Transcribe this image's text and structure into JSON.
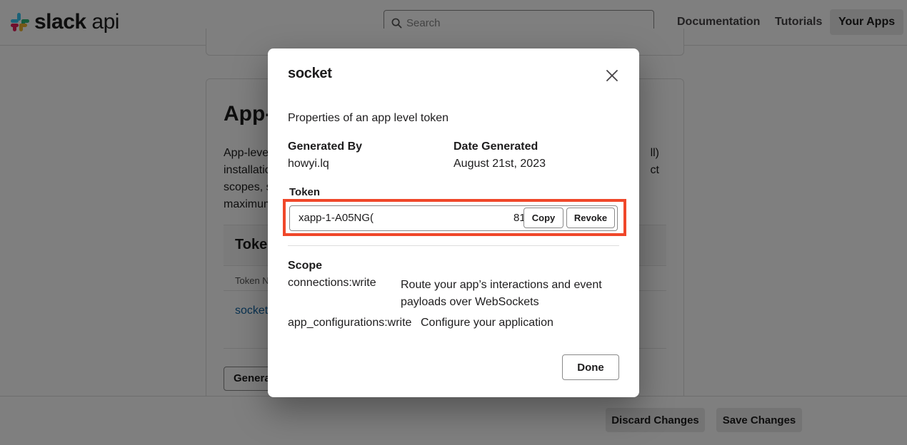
{
  "header": {
    "logo_word": "slack",
    "logo_suffix": "api",
    "search_placeholder": "Search",
    "nav": {
      "documentation": "Documentation",
      "tutorials": "Tutorials",
      "your_apps": "Your Apps"
    }
  },
  "background": {
    "section_title": "App-",
    "desc_lines": [
      {
        "left": "App-leve",
        "right": "ll)"
      },
      {
        "left": "installatio",
        "right": "ct"
      },
      {
        "left": "scopes, s",
        "right": ""
      },
      {
        "left": "maximum",
        "right": ""
      }
    ],
    "tokens_title": "Token",
    "column_header": "Token N",
    "token_link": "socket",
    "generate_button": "Genera"
  },
  "footer": {
    "discard_label": "Discard Changes",
    "save_label": "Save Changes"
  },
  "modal": {
    "title": "socket",
    "subtitle": "Properties of an app level token",
    "generated_by_label": "Generated By",
    "generated_by_value": "howyi.lq",
    "date_label": "Date Generated",
    "date_value": "August 21st, 2023",
    "token_label": "Token",
    "token_visible_start": "xapp-1-A05NG(",
    "token_visible_end": "81",
    "copy_label": "Copy",
    "revoke_label": "Revoke",
    "scope_label": "Scope",
    "scopes": [
      {
        "name": "connections:write",
        "description": "Route your app’s interactions and event payloads over WebSockets"
      },
      {
        "name": "app_configurations:write",
        "description": "Configure your application"
      }
    ],
    "done_label": "Done"
  },
  "colors": {
    "highlight": "#f0472a",
    "link": "#1264a3",
    "overlay": "rgba(0,0,0,0.5)"
  }
}
